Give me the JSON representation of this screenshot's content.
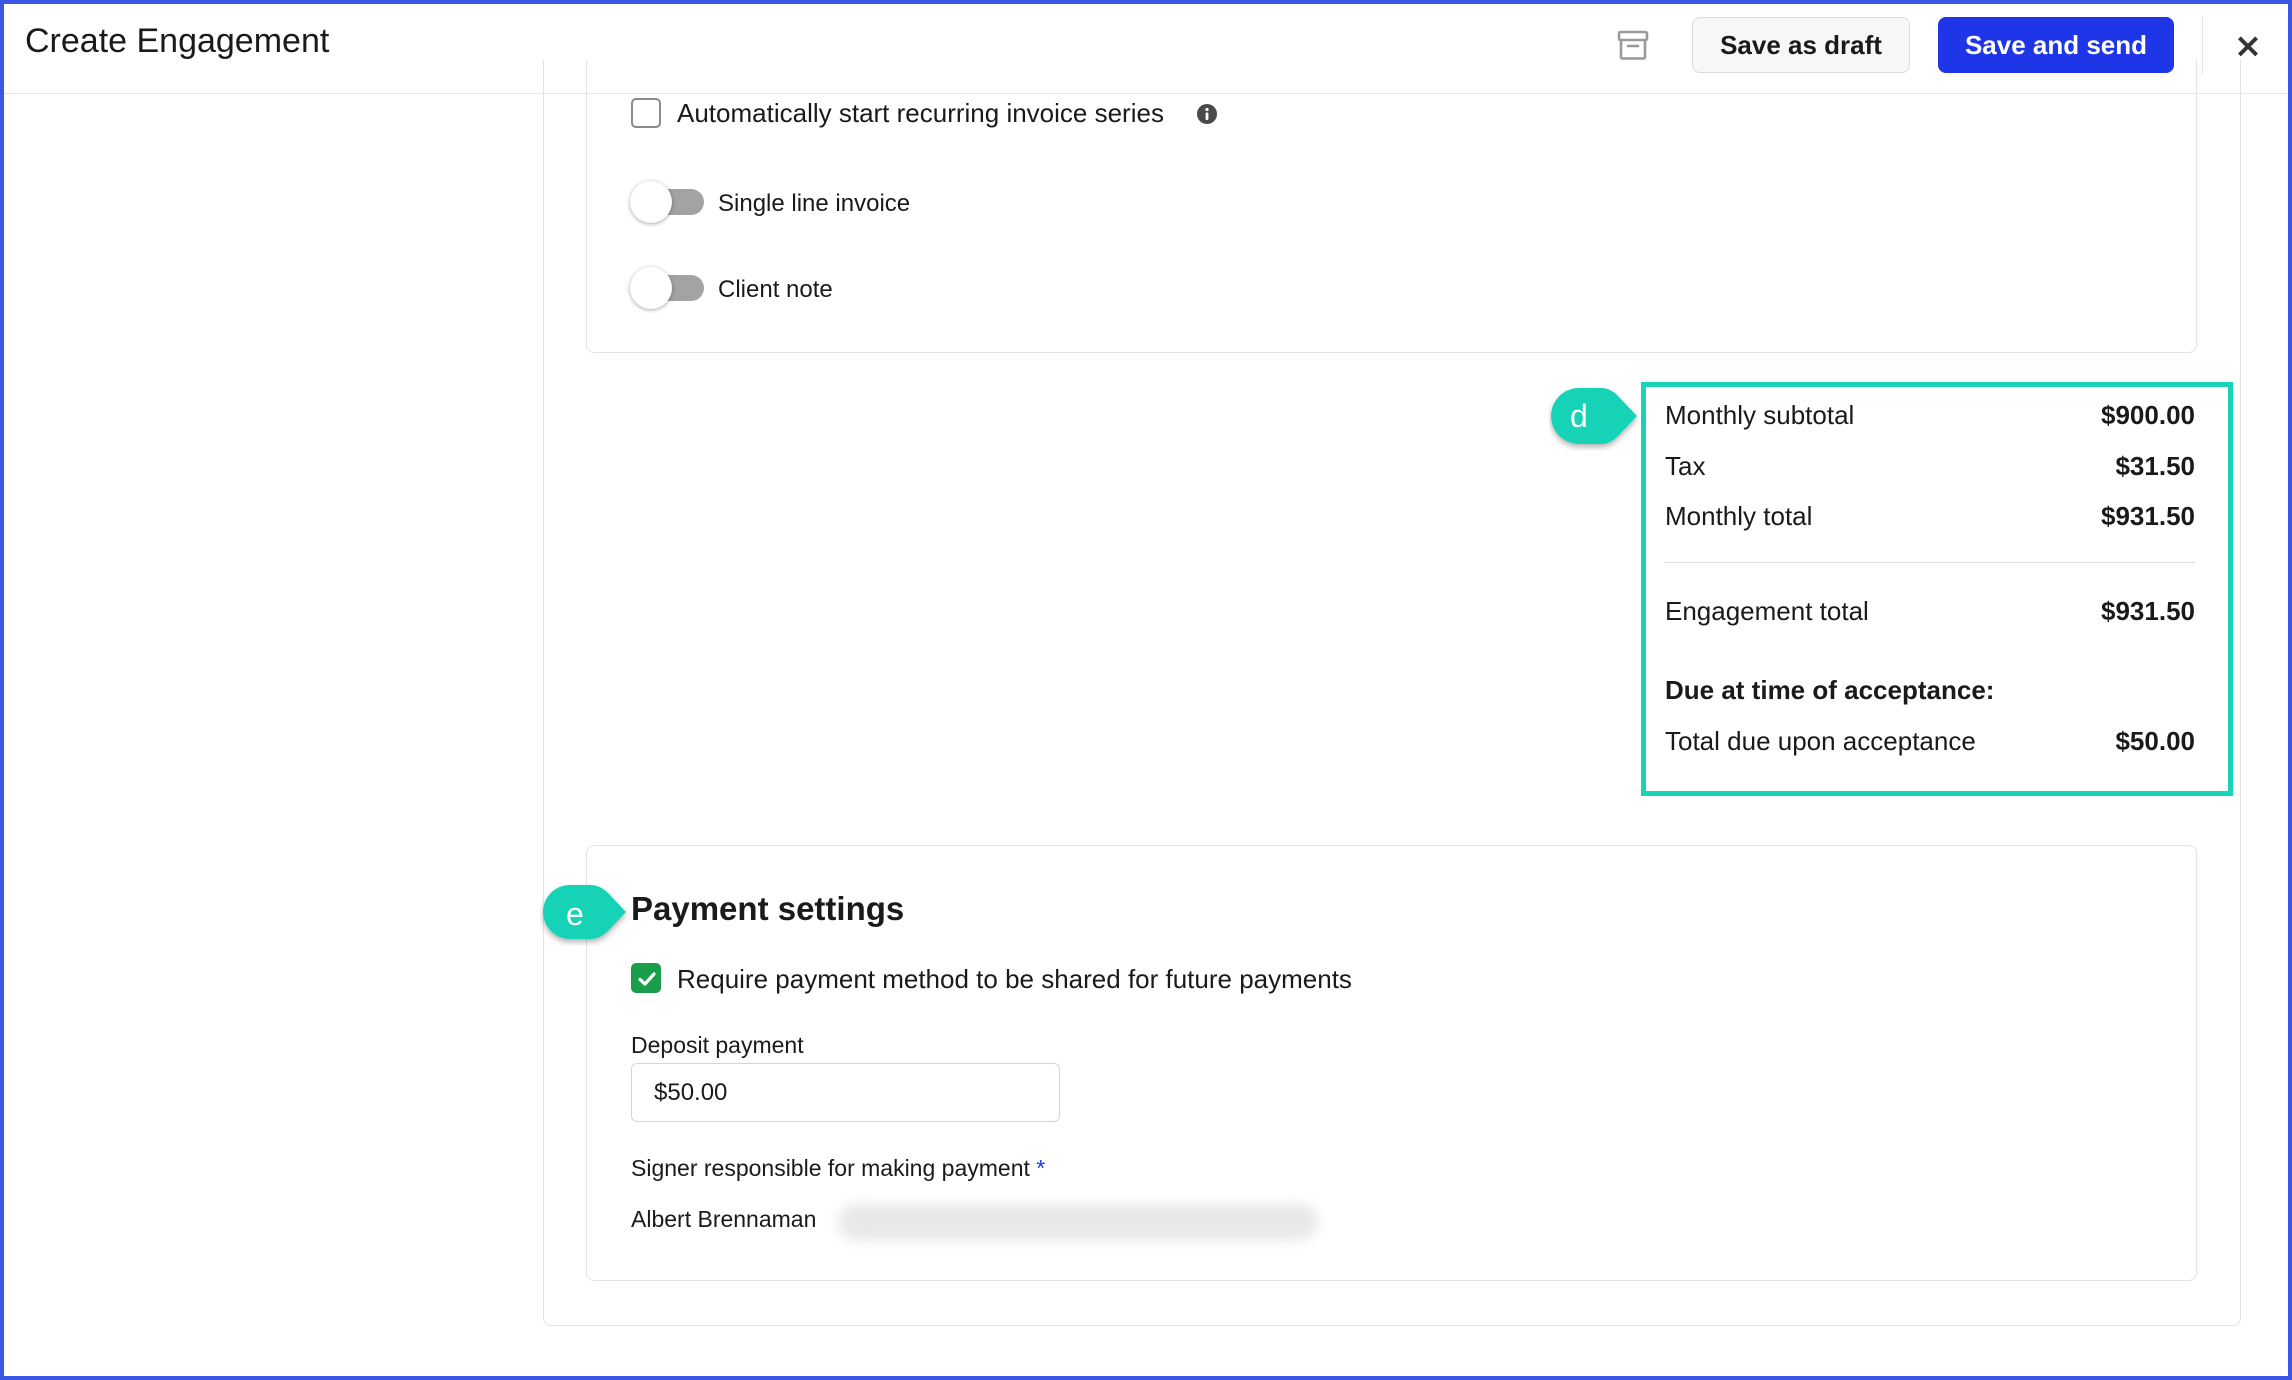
{
  "header": {
    "title": "Create Engagement",
    "archive_icon": "archive-box-icon",
    "save_draft_label": "Save as draft",
    "save_send_label": "Save and send",
    "close_label": "×",
    "accent_color": "#1f36e8"
  },
  "invoice_options": {
    "auto_recurring": {
      "label": "Automatically start recurring invoice series",
      "checked": false,
      "icon": "info-icon"
    },
    "single_line": {
      "label": "Single line invoice",
      "enabled": false
    },
    "client_note": {
      "label": "Client note",
      "enabled": false
    }
  },
  "callouts": {
    "d": "d",
    "e": "e",
    "color": "#19d3b8"
  },
  "summary": {
    "monthly_subtotal_label": "Monthly subtotal",
    "monthly_subtotal_value": "$900.00",
    "tax_label": "Tax",
    "tax_value": "$31.50",
    "monthly_total_label": "Monthly total",
    "monthly_total_value": "$931.50",
    "engagement_total_label": "Engagement total",
    "engagement_total_value": "$931.50",
    "due_heading": "Due at time of acceptance:",
    "total_due_label": "Total due upon acceptance",
    "total_due_value": "$50.00"
  },
  "payment_settings": {
    "title": "Payment settings",
    "require_method_label": "Require payment method to be shared for future payments",
    "require_method_checked": true,
    "deposit_label": "Deposit payment",
    "deposit_value": "$50.00",
    "signer_label": "Signer responsible for making payment",
    "signer_required_mark": "*",
    "signer_name": "Albert Brennaman"
  }
}
